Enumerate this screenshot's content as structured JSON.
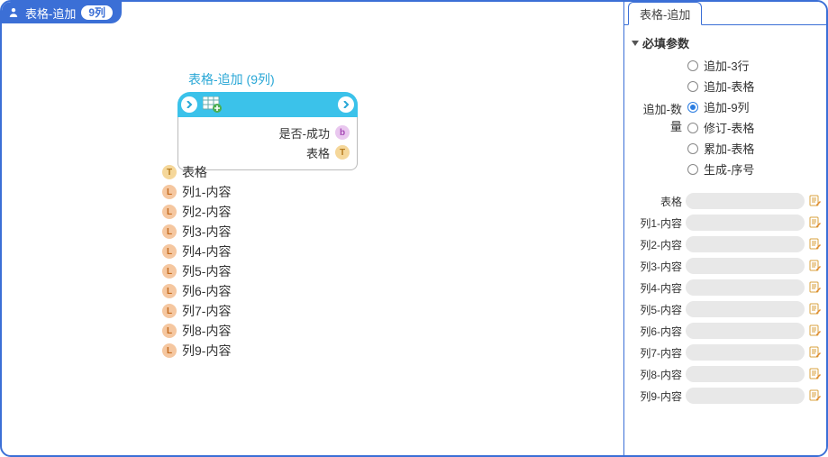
{
  "badge": {
    "title": "表格-追加",
    "pill": "9列"
  },
  "block": {
    "title": "表格-追加 (9列)",
    "outputs": [
      {
        "label": "是否-成功",
        "type": "b"
      },
      {
        "label": "表格",
        "type": "T"
      }
    ],
    "inputs": [
      {
        "label": "表格",
        "type": "T"
      },
      {
        "label": "列1-内容",
        "type": "L"
      },
      {
        "label": "列2-内容",
        "type": "L"
      },
      {
        "label": "列3-内容",
        "type": "L"
      },
      {
        "label": "列4-内容",
        "type": "L"
      },
      {
        "label": "列5-内容",
        "type": "L"
      },
      {
        "label": "列6-内容",
        "type": "L"
      },
      {
        "label": "列7-内容",
        "type": "L"
      },
      {
        "label": "列8-内容",
        "type": "L"
      },
      {
        "label": "列9-内容",
        "type": "L"
      }
    ]
  },
  "panel": {
    "tab": "表格-追加",
    "section": "必填参数",
    "radio_group_label": "追加-数量",
    "radios": [
      {
        "label": "追加-3行",
        "checked": false
      },
      {
        "label": "追加-表格",
        "checked": false
      },
      {
        "label": "追加-9列",
        "checked": true
      },
      {
        "label": "修订-表格",
        "checked": false
      },
      {
        "label": "累加-表格",
        "checked": false
      },
      {
        "label": "生成-序号",
        "checked": false
      }
    ],
    "fields": [
      {
        "label": "表格"
      },
      {
        "label": "列1-内容"
      },
      {
        "label": "列2-内容"
      },
      {
        "label": "列3-内容"
      },
      {
        "label": "列4-内容"
      },
      {
        "label": "列5-内容"
      },
      {
        "label": "列6-内容"
      },
      {
        "label": "列7-内容"
      },
      {
        "label": "列8-内容"
      },
      {
        "label": "列9-内容"
      }
    ]
  }
}
